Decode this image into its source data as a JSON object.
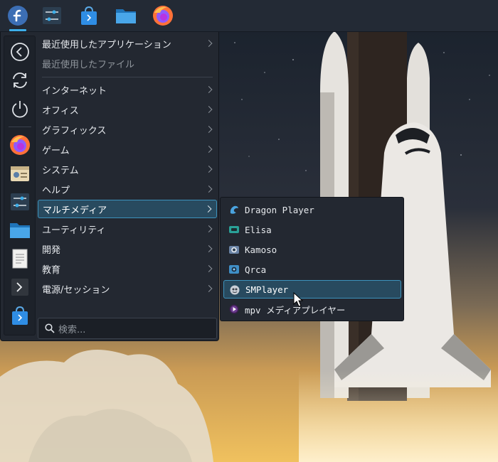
{
  "panel": {
    "items": [
      {
        "id": "app-launcher",
        "icon": "fedora-logo-icon"
      },
      {
        "id": "system-settings",
        "icon": "settings-sliders-icon"
      },
      {
        "id": "discover",
        "icon": "software-store-bag-icon"
      },
      {
        "id": "file-manager",
        "icon": "folder-icon"
      },
      {
        "id": "firefox",
        "icon": "firefox-icon"
      }
    ]
  },
  "favorites": [
    {
      "id": "leave",
      "icon": "leave-arrow-icon"
    },
    {
      "id": "restart",
      "icon": "restart-icon"
    },
    {
      "id": "shutdown",
      "icon": "power-icon"
    },
    {
      "id": "firefox",
      "icon": "firefox-icon"
    },
    {
      "id": "settings-app",
      "icon": "settings-app-icon"
    },
    {
      "id": "system-settings",
      "icon": "settings-sliders-icon"
    },
    {
      "id": "files",
      "icon": "folder-icon"
    },
    {
      "id": "text-editor",
      "icon": "document-icon"
    },
    {
      "id": "terminal",
      "icon": "terminal-icon"
    },
    {
      "id": "discover",
      "icon": "software-store-bag-icon"
    }
  ],
  "menu": {
    "recent_apps": "最近使用したアプリケーション",
    "recent_files": "最近使用したファイル",
    "categories": [
      "インターネット",
      "オフィス",
      "グラフィックス",
      "ゲーム",
      "システム",
      "ヘルプ",
      "マルチメディア",
      "ユーティリティ",
      "開発",
      "教育",
      "電源/セッション"
    ],
    "selected_category": "マルチメディア"
  },
  "search": {
    "placeholder": "検索..."
  },
  "submenu": {
    "items": [
      {
        "label": "Dragon Player",
        "icon": "dragon-player-icon"
      },
      {
        "label": "Elisa",
        "icon": "elisa-icon"
      },
      {
        "label": "Kamoso",
        "icon": "kamoso-icon"
      },
      {
        "label": "Qrca",
        "icon": "qrca-icon"
      },
      {
        "label": "SMPlayer",
        "icon": "smplayer-icon"
      },
      {
        "label": "mpv メディアプレイヤー",
        "icon": "mpv-icon"
      }
    ],
    "selected": "SMPlayer"
  },
  "colors": {
    "accent": "#3daee9",
    "selection_bg": "#284a5f",
    "panel_bg": "#232a35",
    "menu_bg": "#232831"
  }
}
